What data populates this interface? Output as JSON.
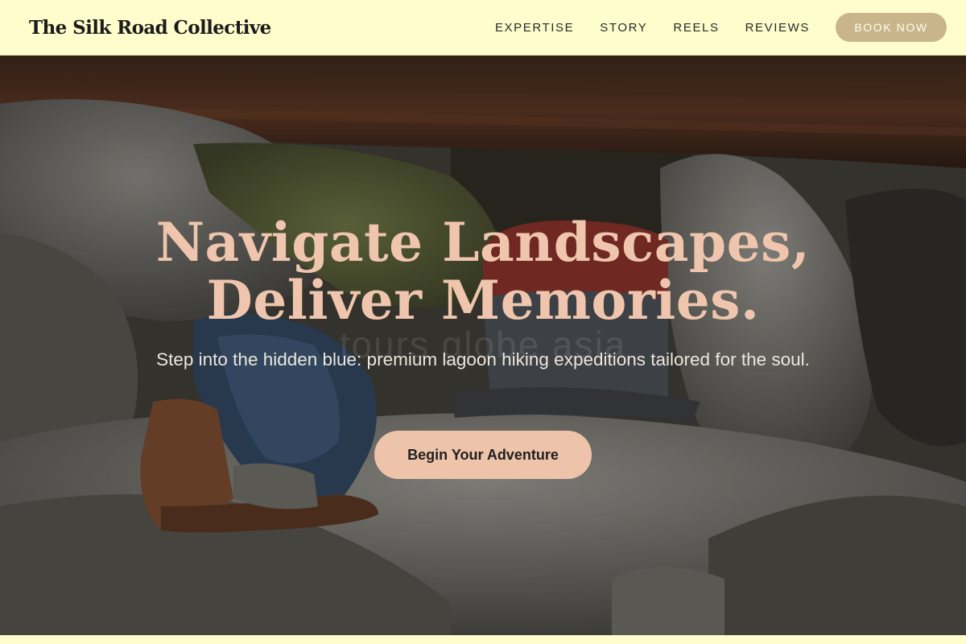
{
  "header": {
    "brand": "The Silk Road Collective",
    "nav": [
      "EXPERTISE",
      "STORY",
      "REELS",
      "REVIEWS"
    ],
    "book_label": "BOOK NOW"
  },
  "hero": {
    "headline_line1": "Navigate Landscapes,",
    "headline_line2": "Deliver Memories.",
    "watermark": "tours globe asia",
    "subtitle": "Step into the hidden blue: premium lagoon hiking expeditions tailored for the soul.",
    "cta_label": "Begin Your Adventure",
    "background_image": "hiking-gear-on-rocks-photo"
  },
  "colors": {
    "nav_bg": "#fffdcc",
    "accent_button": "#c8b68a",
    "headline": "#efc6ad",
    "cta_bg": "#edc3aa"
  }
}
